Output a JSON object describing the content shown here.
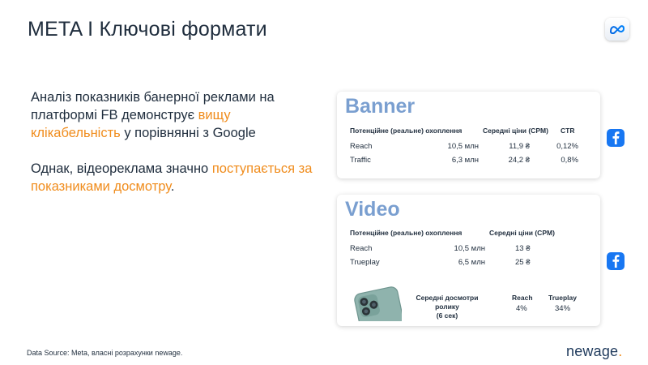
{
  "slide": {
    "title": "META I Ключові формати",
    "intro_p1": {
      "t1": "Аналіз показників банерної реклами на платформі FB демонструє ",
      "h1": "вищу клікабельність",
      "t2": " у порівнянні з Google"
    },
    "intro_p2": {
      "t1": "Однак, відеореклама значно ",
      "h1": "поступається за показниками досмотру",
      "t2": "."
    },
    "accent_color": "#f08c1c",
    "card_title_color": "#7a9fd0"
  },
  "banner": {
    "title": "Banner",
    "col_reach": "Потенційне (реальне) охоплення",
    "col_cpm": "Середні ціни (CPM)",
    "col_ctr": "CTR",
    "rows": [
      {
        "label": "Reach",
        "reach": "10,5 млн",
        "cpm": "11,9 ₴",
        "ctr": "0,12%"
      },
      {
        "label": "Traffic",
        "reach": "6,3 млн",
        "cpm": "24,2 ₴",
        "ctr": "0,8%"
      }
    ]
  },
  "video": {
    "title": "Video",
    "col_reach": "Потенційне (реальне) охоплення",
    "col_cpm": "Середні ціни (CPM)",
    "rows": [
      {
        "label": "Reach",
        "reach": "10,5 млн",
        "cpm": "13 ₴"
      },
      {
        "label": "Trueplay",
        "reach": "6,5 млн",
        "cpm": "25 ₴"
      }
    ],
    "views_label_line1": "Середні досмотри ролику",
    "views_label_line2": "(6 сек)",
    "views_reach_header": "Reach",
    "views_trueplay_header": "Trueplay",
    "views_reach_value": "4%",
    "views_trueplay_value": "34%"
  },
  "icons": {
    "platform": "facebook-icon",
    "brand": "meta-logo-icon",
    "device": "smartphone-icon"
  },
  "footer": {
    "source": "Data Source: Meta, власні розрахунки newage.",
    "logo_text": "newage",
    "logo_dot": "."
  }
}
